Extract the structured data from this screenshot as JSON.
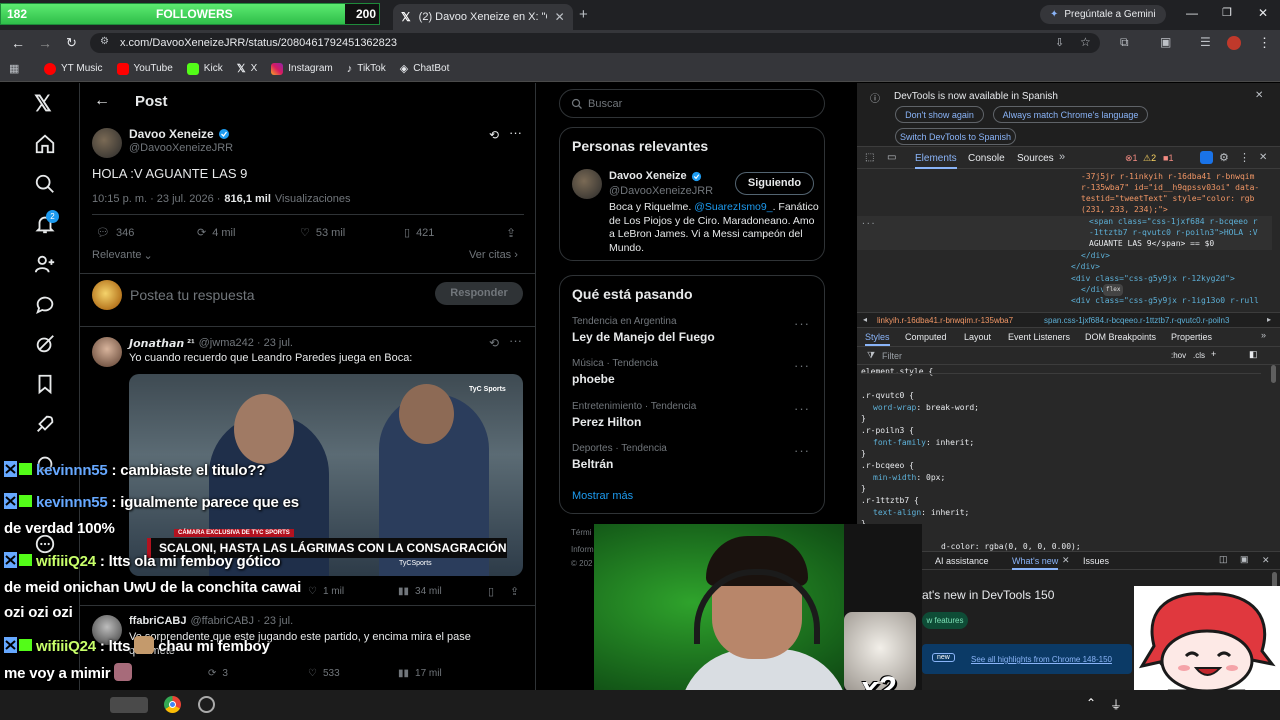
{
  "stream": {
    "followers_current": "182",
    "followers_label": "FOLLOWERS",
    "followers_goal": "200",
    "followers_progress": 0.91,
    "chat": [
      {
        "user": "kevinnn55",
        "text": ": cambiaste el titulo??"
      },
      {
        "user": "kevinnn55",
        "text": ": igualmente parece que es"
      },
      {
        "user": "",
        "text": "de verdad 100%"
      },
      {
        "user": "wifiiiQ24",
        "text": ": ltts ola mi femboy gótico"
      },
      {
        "user": "",
        "text": "de meid onichan UwU de la conchita cawai"
      },
      {
        "user": "",
        "text": "ozi ozi ozi"
      },
      {
        "user": "wifiiiQ24",
        "text": ": ltts"
      },
      {
        "user": "",
        "text": "chau mi femboy"
      },
      {
        "user": "",
        "text": "me voy a mimir"
      },
      {
        "user": "wifiiiQ24",
        "text": ":"
      }
    ],
    "webcam_multiplier": "x2"
  },
  "browser": {
    "tab_title": "(2) Davoo Xeneize en X: \"Gracia",
    "gemini_label": "Pregúntale a Gemini",
    "url": "x.com/DavooXeneizeJRR/status/2080461792451362823",
    "bookmarks": [
      "YT Music",
      "YouTube",
      "Kick",
      "X",
      "Instagram",
      "TikTok",
      "ChatBot"
    ]
  },
  "x": {
    "header_title": "Post",
    "author_name": "Davoo Xeneize",
    "author_handle": "@DavooXeneizeJRR",
    "post_text": "HOLA :V AGUANTE LAS 9",
    "post_time": "10:15 p. m. · 23 jul. 2026 ·",
    "views_count": "816,1 mil",
    "views_label": "Visualizaciones",
    "replies": "346",
    "reposts": "4 mil",
    "likes": "53 mil",
    "bookmarks": "421",
    "filter_label": "Relevante",
    "quotes_label": "Ver citas",
    "reply_placeholder": "Postea tu respuesta",
    "reply_button": "Responder",
    "notif_count": "2",
    "reply1": {
      "name": "𝙅𝙤𝙣𝙖𝙩𝙝𝙖𝙣 ²¹",
      "handle": "@jwma242 · 23 jul.",
      "text": "Yo cuando recuerdo que Leandro Paredes juega en Boca:",
      "likes": "1 mil",
      "views": "34 mil",
      "video_brand": "TyC Sports",
      "video_caption_small": "CÁMARA EXCLUSIVA DE TYC SPORTS",
      "video_caption": "SCALONI, HASTA LAS LÁGRIMAS CON LA CONSAGRACIÓN",
      "video_tag": "TyCSports"
    },
    "reply2": {
      "name": "ffabriCABJ",
      "handle": "@ffabriCABJ · 23 jul.",
      "text": "Vo sorprendente que este jugando este partido, y encima mira el pase",
      "text2": "que mete",
      "reposts": "3",
      "likes": "533",
      "views": "17 mil"
    },
    "search_placeholder": "Buscar",
    "relevant": {
      "title": "Personas relevantes",
      "name": "Davoo Xeneize",
      "handle": "@DavooXeneizeJRR",
      "follow_button": "Siguiendo",
      "bio_pre": "Boca y Riquelme. ",
      "bio_link": "@SuarezIsmo9_",
      "bio_post": ". Fanático de Los Piojos y de Ciro. Maradoneano. Amo a LeBron James. Vi a Messi campeón del Mundo."
    },
    "trends": {
      "title": "Qué está pasando",
      "items": [
        {
          "category": "Tendencia en Argentina",
          "name": "Ley de Manejo del Fuego"
        },
        {
          "category": "Música · Tendencia",
          "name": "phoebe"
        },
        {
          "category": "Entretenimiento · Tendencia",
          "name": "Perez Hilton"
        },
        {
          "category": "Deportes · Tendencia",
          "name": "Beltrán"
        }
      ],
      "show_more": "Mostrar más"
    },
    "footer_fragments": [
      "Térmi",
      "Inform",
      "© 202"
    ]
  },
  "devtools": {
    "banner": "DevTools is now available in Spanish",
    "btn_dont_show": "Don't show again",
    "btn_match": "Always match Chrome's language",
    "btn_switch": "Switch DevTools to Spanish",
    "tabs": [
      "Elements",
      "Console",
      "Sources"
    ],
    "error_count": "1",
    "warning_count": "2",
    "info_count": "1",
    "breadcrumb_1": "linkyih.r-16dba41.r-bnwqim.r-135wba7",
    "breadcrumb_2": "span.css-1jxf684.r-bcqeeo.r-1ttztb7.r-qvutc0.r-poiln3",
    "subtabs": [
      "Styles",
      "Computed",
      "Layout",
      "Event Listeners",
      "DOM Breakpoints",
      "Properties"
    ],
    "filter_placeholder": "Filter",
    "filter_hov": ":hov",
    "filter_cls": ".cls",
    "dom_lines": [
      "-37j5jr r-1inkyih r-16dba41 r-bnwqim",
      "r-135wba7\" id=\"id__h9qpssv03oi\" data-",
      "testid=\"tweetText\" style=\"color: rgb",
      "(231, 233, 234);\">",
      "<span class=\"css-1jxf684 r-bcqeeo r",
      "-1ttztb7 r-qvutc0 r-poiln3\">HOLA :V",
      "AGUANTE LAS 9</span> == $0",
      "</div>",
      "</div>",
      "<div class=\"css-g5y9jx r-12kyg2d\">",
      "</div>",
      "<div class=\"css-g5y9jx r-1ig13o0 r-rull"
    ],
    "flex_badge": "flex",
    "css_rules": [
      {
        "selector": "element.style {",
        "prop": "",
        "value": ""
      },
      {
        "selector": ".r-qvutc0 {",
        "prop": "word-wrap",
        "value": "break-word;"
      },
      {
        "selector": ".r-poiln3 {",
        "prop": "font-family",
        "value": "inherit;"
      },
      {
        "selector": ".r-bcqeeo {",
        "prop": "min-width",
        "value": "0px;"
      },
      {
        "selector": ".r-1ttztb7 {",
        "prop": "text-align",
        "value": "inherit;"
      }
    ],
    "partial_rule": "d-color: rgba(0, 0, 0, 0.00);",
    "drawer_tabs": [
      "AI assistance",
      "What's new",
      "Issues"
    ],
    "whats_new_title": "at's new in DevTools 150",
    "new_features": "w features",
    "new_badge": "new",
    "highlights_link": "See all highlights from Chrome 148-150"
  },
  "colors": {
    "x_blue": "#1d9bf0",
    "followers_green": "#3cd35a",
    "devtools_accent": "#8ab4f8"
  }
}
